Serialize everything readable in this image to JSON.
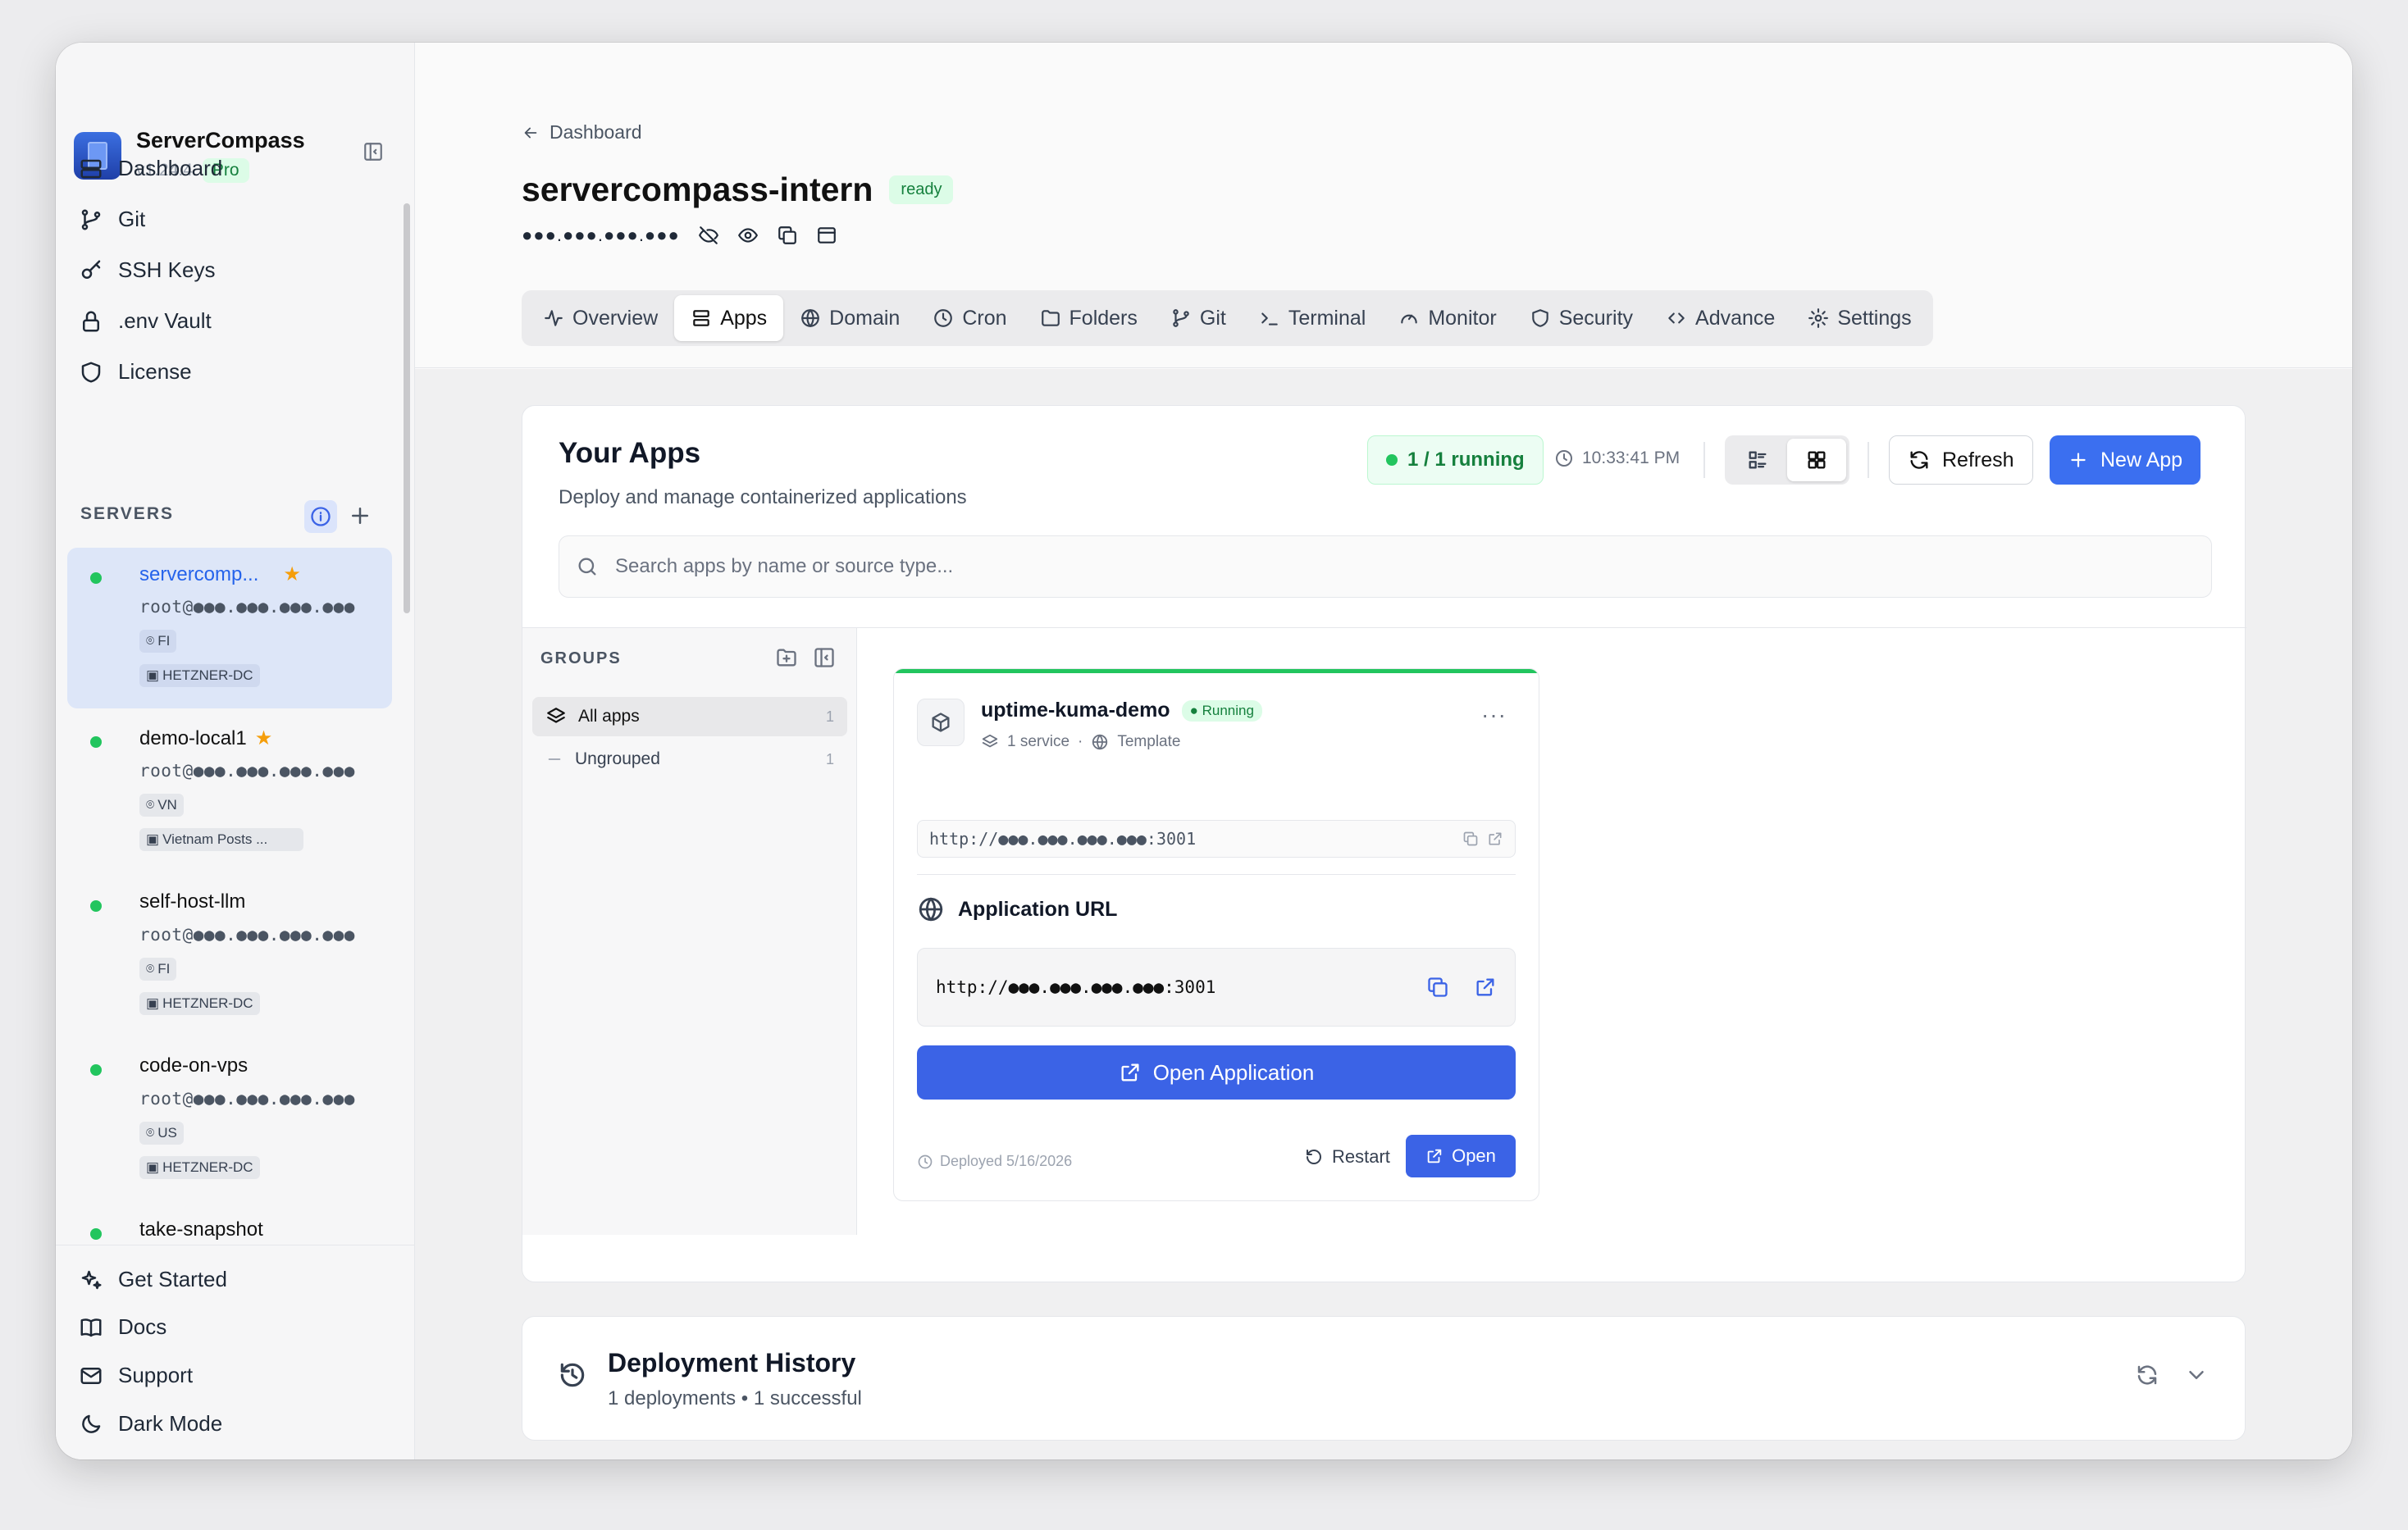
{
  "app": {
    "name": "ServerCompass",
    "version": "v1.24.4",
    "tier": "Pro"
  },
  "nav": [
    {
      "label": "Dashboard",
      "icon": "server-icon"
    },
    {
      "label": "Git",
      "icon": "git-branch-icon"
    },
    {
      "label": "SSH Keys",
      "icon": "key-icon"
    },
    {
      "label": ".env Vault",
      "icon": "lock-icon"
    },
    {
      "label": "License",
      "icon": "shield-icon"
    }
  ],
  "servers_heading": "SERVERS",
  "servers": [
    {
      "name": "servercomp...",
      "host": "root@●●●.●●●.●●●.●●●",
      "region": "FI",
      "provider": "HETZNER-DC",
      "starred": true,
      "selected": true
    },
    {
      "name": "demo-local1",
      "host": "root@●●●.●●●.●●●.●●●",
      "region": "VN",
      "provider": "Vietnam Posts ...",
      "starred": true
    },
    {
      "name": "self-host-llm",
      "host": "root@●●●.●●●.●●●.●●●",
      "region": "FI",
      "provider": "HETZNER-DC"
    },
    {
      "name": "code-on-vps",
      "host": "root@●●●.●●●.●●●.●●●",
      "region": "US",
      "provider": "HETZNER-DC"
    },
    {
      "name": "take-snapshot"
    }
  ],
  "bottom_nav": [
    {
      "label": "Get Started",
      "icon": "sparkles-icon"
    },
    {
      "label": "Docs",
      "icon": "book-icon"
    },
    {
      "label": "Support",
      "icon": "mail-icon"
    },
    {
      "label": "Dark Mode",
      "icon": "moon-icon"
    }
  ],
  "header": {
    "back_label": "Dashboard",
    "server_title": "servercompass-intern",
    "status": "ready",
    "ip_masked": "●●●.●●●.●●●.●●●"
  },
  "tabs": [
    {
      "label": "Overview",
      "icon": "activity-icon"
    },
    {
      "label": "Apps",
      "icon": "layers-icon",
      "active": true
    },
    {
      "label": "Domain",
      "icon": "globe-icon"
    },
    {
      "label": "Cron",
      "icon": "clock-icon"
    },
    {
      "label": "Folders",
      "icon": "folder-icon"
    },
    {
      "label": "Git",
      "icon": "git-branch-icon"
    },
    {
      "label": "Terminal",
      "icon": "terminal-icon"
    },
    {
      "label": "Monitor",
      "icon": "gauge-icon"
    },
    {
      "label": "Security",
      "icon": "shield-icon"
    },
    {
      "label": "Advance",
      "icon": "code-icon"
    },
    {
      "label": "Settings",
      "icon": "gear-icon"
    }
  ],
  "apps_panel": {
    "title": "Your Apps",
    "subtitle": "Deploy and manage containerized applications",
    "running": "1 / 1 running",
    "time": "10:33:41 PM",
    "refresh_label": "Refresh",
    "new_app_label": "New App",
    "search_placeholder": "Search apps by name or source type..."
  },
  "groups": {
    "heading": "GROUPS",
    "items": [
      {
        "label": "All apps",
        "count": "1"
      },
      {
        "label": "Ungrouped",
        "count": "1"
      }
    ]
  },
  "app_card": {
    "name": "uptime-kuma-demo",
    "status": "Running",
    "services": "1 service",
    "source": "Template",
    "internal_url": "http://●●●.●●●.●●●.●●●:3001",
    "app_url_heading": "Application URL",
    "app_url": "http://●●●.●●●.●●●.●●●:3001",
    "open_application_label": "Open Application",
    "deployed": "Deployed 5/16/2026",
    "restart_label": "Restart",
    "open_label": "Open"
  },
  "history": {
    "title": "Deployment History",
    "summary": "1 deployments • 1 successful"
  },
  "colors": {
    "accent": "#3b63e6",
    "success": "#22c55e",
    "star": "#f59e0b"
  }
}
